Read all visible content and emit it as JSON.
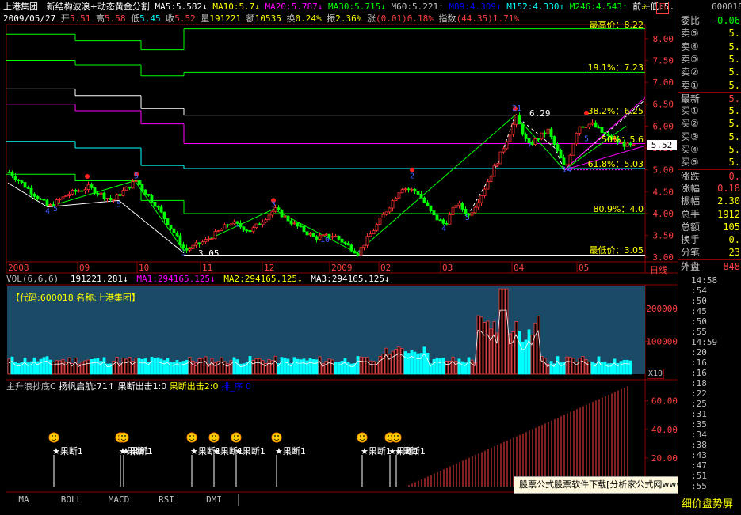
{
  "header": {
    "stock_name": "上港集团",
    "indicator_name": "新结构波浪+动态黄金分割",
    "ma_items": [
      {
        "label": "MA5:5.582",
        "arrow": "↓",
        "color": "#ffffff"
      },
      {
        "label": "MA10:5.7",
        "arrow": "↓",
        "color": "#ffff00"
      },
      {
        "label": "MA20:5.787",
        "arrow": "↓",
        "color": "#ff00ff"
      },
      {
        "label": "MA30:5.715",
        "arrow": "↓",
        "color": "#00ff00"
      },
      {
        "label": "M60:5.221",
        "arrow": "↑",
        "color": "#c0c0c0"
      },
      {
        "label": "M89:4.309",
        "arrow": "↑",
        "color": "#0000ff"
      },
      {
        "label": "M152:4.330",
        "arrow": "↑",
        "color": "#00ffff"
      },
      {
        "label": "M246:4.543",
        "arrow": "↑",
        "color": "#00ff00"
      },
      {
        "label": "前一低:5.",
        "arrow": "",
        "color": "#ffffff"
      }
    ],
    "info_date": "2009/05/27",
    "info_items": [
      {
        "label": "开",
        "value": "5.51",
        "color": "#ff4040"
      },
      {
        "label": "高",
        "value": "5.58",
        "color": "#ff4040"
      },
      {
        "label": "低",
        "value": "5.45",
        "color": "#00ffff"
      },
      {
        "label": "收",
        "value": "5.52",
        "color": "#ff4040"
      },
      {
        "label": "量",
        "value": "191221",
        "color": "#ffff00"
      },
      {
        "label": "额",
        "value": "10535",
        "color": "#ffff00"
      },
      {
        "label": "换",
        "value": "0.24%",
        "color": "#ffff00"
      },
      {
        "label": "振",
        "value": "2.36%",
        "color": "#ffff00"
      },
      {
        "label": "涨",
        "value": "(0.01)0.18%",
        "color": "#ff4040"
      },
      {
        "label": "指数",
        "value": "(44.35)1.71%",
        "color": "#ff4040"
      }
    ]
  },
  "main_chart": {
    "price_axis": [
      "8.00",
      "7.50",
      "7.00",
      "6.50",
      "6.00",
      "5.50",
      "5.00",
      "4.50",
      "4.00",
      "3.50",
      "3.00"
    ],
    "current_price_tag": "5.52",
    "fib_labels": [
      {
        "text": "最高价：8.22",
        "color": "#ffff00"
      },
      {
        "text": "19.1%：7.23",
        "color": "#ffff00"
      },
      {
        "text": "38.2%：6.25",
        "color": "#ffff00"
      },
      {
        "text": "50%：5.6",
        "color": "#ffff00"
      },
      {
        "text": "61.8%：5.03",
        "color": "#ffff00"
      },
      {
        "text": "80.9%：4.0",
        "color": "#ffff00"
      },
      {
        "text": "最低价：3.05",
        "color": "#ffff00"
      }
    ],
    "low_annot": "3.05",
    "high_annot": "6.29",
    "time_axis": [
      "2008",
      "09",
      "10",
      "11",
      "12",
      "2009",
      "02",
      "03",
      "04",
      "05"
    ],
    "period_label": "日线"
  },
  "volume_panel": {
    "title": "VOL(6,6,6)",
    "vol_value": "191221.281",
    "ma1": "MA1:294165.125",
    "ma2": "MA2:294165.125",
    "ma3": "MA3:294165.125",
    "code_label": "【代码:600018 名称:上港集团】",
    "axis": [
      "200000",
      "100000"
    ],
    "scale": "X10"
  },
  "signal_panel": {
    "title": "主升浪抄底C",
    "items": [
      {
        "text": "扬帆启航:71",
        "arrow": "↑",
        "color": "#ffffff"
      },
      {
        "text": "果断出击1:0",
        "arrow": "",
        "color": "#ffffff"
      },
      {
        "text": "果断出击2:0",
        "arrow": "",
        "color": "#ffff00"
      },
      {
        "text": "排_序 0",
        "arrow": "",
        "color": "#0000ff"
      }
    ],
    "axis": [
      "60.00",
      "40.00",
      "20.00"
    ],
    "signal_label": "果断1"
  },
  "tabs": [
    "MA",
    "BOLL",
    "MACD",
    "RSI",
    "DMI"
  ],
  "sidebar": {
    "code": "600018",
    "rows": [
      {
        "label": "委比",
        "value": "-0.06",
        "color": "#00ff00"
      },
      {
        "label": "卖⑤",
        "value": "5.",
        "color": "#ffff00"
      },
      {
        "label": "卖④",
        "value": "5.",
        "color": "#ffff00"
      },
      {
        "label": "卖③",
        "value": "5.",
        "color": "#ffff00"
      },
      {
        "label": "卖②",
        "value": "5.",
        "color": "#ffff00"
      },
      {
        "label": "卖①",
        "value": "5.",
        "color": "#ffff00"
      },
      {
        "label": "最新",
        "value": "5.",
        "color": "#ff4040"
      },
      {
        "label": "买①",
        "value": "5.",
        "color": "#ffff00"
      },
      {
        "label": "买②",
        "value": "5.",
        "color": "#ffff00"
      },
      {
        "label": "买③",
        "value": "5.",
        "color": "#ffff00"
      },
      {
        "label": "买④",
        "value": "5.",
        "color": "#ffff00"
      },
      {
        "label": "买⑤",
        "value": "5.",
        "color": "#ffff00"
      },
      {
        "label": "涨跌",
        "value": "0.",
        "color": "#ff4040"
      },
      {
        "label": "涨幅",
        "value": "0.18",
        "color": "#ff4040"
      },
      {
        "label": "振幅",
        "value": "2.30",
        "color": "#ffff00"
      },
      {
        "label": "总手",
        "value": "1912",
        "color": "#ffff00"
      },
      {
        "label": "总额",
        "value": "105",
        "color": "#ffff00"
      },
      {
        "label": "换手",
        "value": "0.",
        "color": "#ffff00"
      },
      {
        "label": "分笔",
        "value": "23",
        "color": "#ffff00"
      },
      {
        "label": "外盘",
        "value": "848",
        "color": "#ff4040"
      }
    ],
    "tick_times": [
      "14:58",
      ":54",
      ":50",
      ":45",
      ":50",
      ":55",
      "14:59",
      ":20",
      ":16",
      ":16",
      ":18",
      ":22",
      ":25",
      ":31",
      ":35",
      ":34",
      ":38",
      ":43",
      ":47",
      ":51",
      ":55"
    ],
    "bottom_label": "细价盘势屏"
  },
  "watermark": "股票公式股票软件下载[分析家公式网www.88gs.com]"
}
